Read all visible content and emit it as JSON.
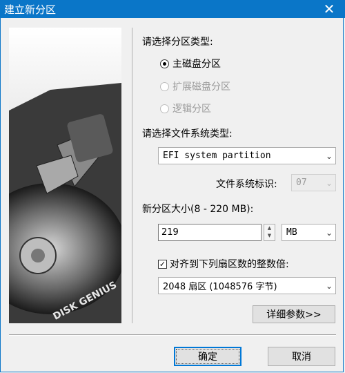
{
  "window": {
    "title": "建立新分区"
  },
  "partition_type": {
    "label": "请选择分区类型:",
    "options": [
      "主磁盘分区",
      "扩展磁盘分区",
      "逻辑分区"
    ]
  },
  "filesystem": {
    "label": "请选择文件系统类型:",
    "selected": "EFI system partition",
    "id_label": "文件系统标识:",
    "id_value": "07"
  },
  "size": {
    "label": "新分区大小(8 - 220 MB):",
    "value": "219",
    "unit": "MB"
  },
  "align": {
    "label": "对齐到下列扇区数的整数倍:",
    "checked": true,
    "selected": "2048 扇区 (1048576 字节)"
  },
  "buttons": {
    "details": "详细参数>>",
    "ok": "确定",
    "cancel": "取消"
  },
  "image": {
    "logo_text": "DISK GENIUS"
  }
}
